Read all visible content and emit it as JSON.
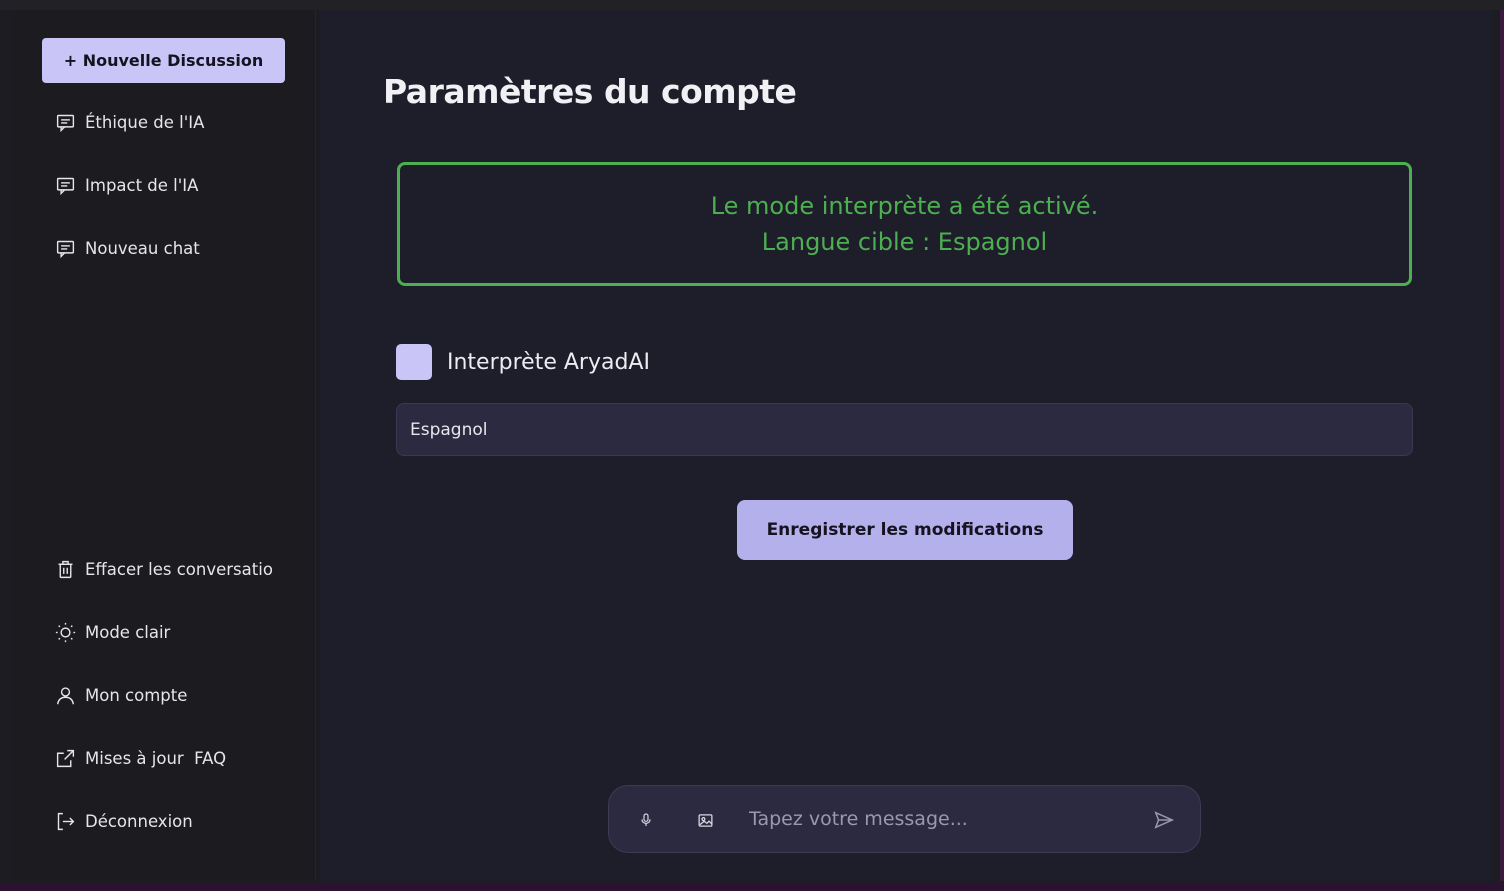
{
  "sidebar": {
    "new_chat_label": "+ Nouvelle Discussion",
    "conversations": [
      {
        "label": "Éthique de l'IA",
        "icon": "chat-icon"
      },
      {
        "label": "Impact de l'IA",
        "icon": "chat-icon"
      },
      {
        "label": "Nouveau chat",
        "icon": "chat-icon"
      }
    ],
    "actions": [
      {
        "label": "Effacer les conversations",
        "icon": "trash-icon"
      },
      {
        "label": "Mode clair",
        "icon": "sun-icon"
      },
      {
        "label": "Mon compte",
        "icon": "user-icon"
      },
      {
        "label": "Mises à jour  FAQ",
        "icon": "external-link-icon"
      },
      {
        "label": "Déconnexion",
        "icon": "logout-icon"
      }
    ]
  },
  "main": {
    "title": "Paramètres du compte",
    "alert": {
      "line1": "Le mode interprète a été activé.",
      "line2": "Langue cible : Espagnol"
    },
    "interpreter": {
      "label": "Interprète AryadAI",
      "checked": true
    },
    "language_value": "Espagnol",
    "save_label": "Enregistrer les modifications"
  },
  "composer": {
    "placeholder": "Tapez votre message...",
    "mic_icon": "microphone-icon",
    "image_icon": "image-icon",
    "send_icon": "send-icon"
  },
  "colors": {
    "accent": "#c9c5f7",
    "success": "#4caf50",
    "main_bg": "#1e1d2a",
    "sidebar_bg": "#1b1b20"
  }
}
